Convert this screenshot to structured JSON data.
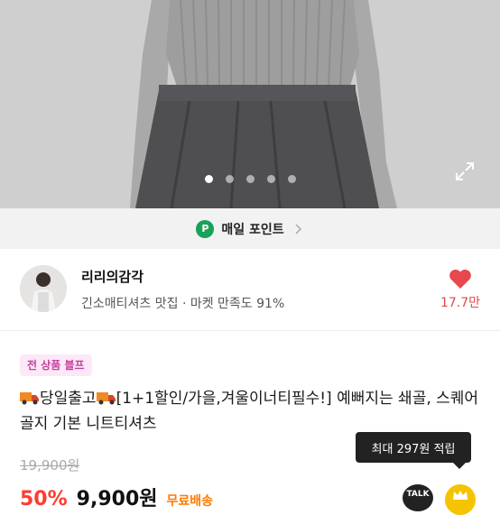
{
  "hero": {
    "image_icon": "product-photo",
    "slide_dots": [
      true,
      false,
      false,
      false,
      false
    ],
    "expand_icon": "expand-icon"
  },
  "points_bar": {
    "badge": "P",
    "label": "매일 포인트",
    "badge_color": "#19a05a",
    "chevron_icon": "chevron-right-icon"
  },
  "shop": {
    "name": "리리의감각",
    "subtitle": "긴소매티셔츠 맛집 · 마켓 만족도 91%",
    "likes": "17.7만",
    "heart_icon": "heart-icon",
    "heart_color": "#e8474d"
  },
  "product": {
    "sale_badge": "전 상품 블프",
    "title_part1": "당일출고",
    "title_part2": "[1+1할인/가을,겨울이너티필수!] 예뻐지는 쇄골, 스퀘어 골지 기본 니트티셔츠",
    "original_price": "19,900원",
    "discount": "50%",
    "price": "9,900원",
    "shipping": "무료배송",
    "accent_color": "#ff3b30"
  },
  "tooltip": {
    "text": "최대 297원 적립"
  },
  "floating": {
    "talk_label": "TALK",
    "coin_icon": "crown-coin-icon"
  }
}
